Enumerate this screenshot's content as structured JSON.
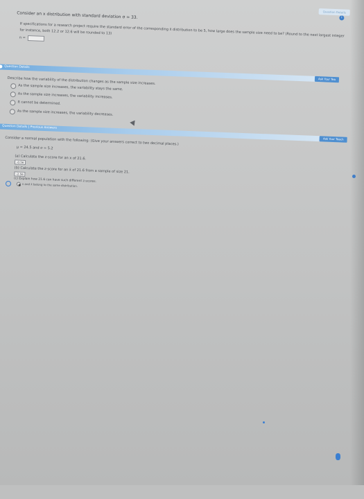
{
  "q1": {
    "tab_label": "Question Details",
    "stem": "Consider an x distribution with standard deviation σ = 33.",
    "prompt": "If specifications for a research project require the standard error of the corresponding x̄ distribution to be 5, how large does the sample size need to be? (Round to the next largest integer",
    "note": "for instance, both 12.2 or 12.6 will be rounded to 13)",
    "answer_label": "n ="
  },
  "q6": {
    "number": "6.",
    "section_title": "Question Details",
    "ask_label": "Ask Your Tea",
    "prompt": "Describe how the variability of the distribution changes as the sample size increases.",
    "options": [
      "As the sample size increases, the variability stays the same.",
      "As the sample size increases, the variability increases.",
      "It cannot be determined.",
      "As the sample size increases, the variability decreases."
    ]
  },
  "q7": {
    "number": "7.",
    "section_title": "Question Details | Previous Answers",
    "ask_label": "Ask Your Teach",
    "stem": "Consider a normal population with the following: (Give your answers correct to two decimal places.)",
    "params": "μ = 24.5 and σ = 5.2",
    "part_a": "(a) Calculate the z-score for an x of 21.6.",
    "part_a_answer": "-0.56",
    "part_b": "(b) Calculate the z-score for an x̄ of 21.6 from a sample of size 21.",
    "part_b_answer": "-2.56",
    "part_c": "(c) Explain how 21.6 can have such different z-scores.",
    "part_c_option": "x and x̄ belong to the same distribution."
  }
}
